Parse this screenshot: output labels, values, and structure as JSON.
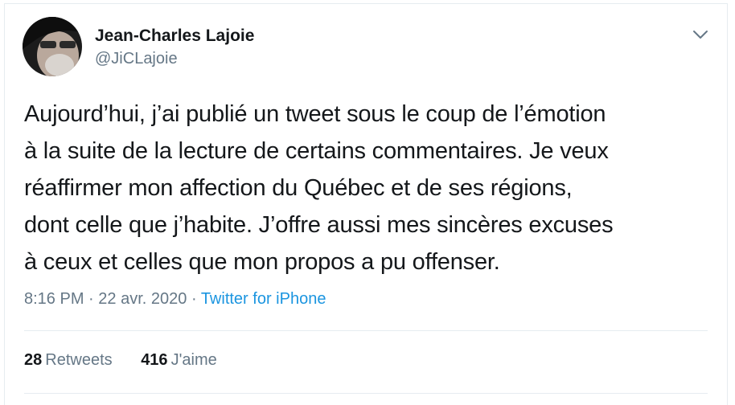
{
  "author": {
    "name": "Jean-Charles Lajoie",
    "handle": "@JiCLajoie",
    "avatar_icon": "profile-photo"
  },
  "tweet": {
    "text": "Aujourd’hui, j’ai publié un tweet sous le coup de l’émotion\nà la suite de la lecture de certains commentaires. Je veux\nréaffirmer mon affection du Québec et de ses régions,\ndont celle que j’habite. J’offre aussi mes sincères excuses\nà ceux et celles que mon propos a pu offenser.",
    "time": "8:16 PM",
    "date": "22 avr. 2020",
    "separator": "·",
    "source": "Twitter for iPhone"
  },
  "stats": {
    "retweets_count": "28",
    "retweets_label": "Retweets",
    "likes_count": "416",
    "likes_label": "J'aime"
  },
  "menu": {
    "caret_icon": "chevron-down-icon"
  },
  "colors": {
    "text": "#14171a",
    "secondary": "#657786",
    "link": "#1b95e0",
    "border": "#e6ecf0"
  }
}
